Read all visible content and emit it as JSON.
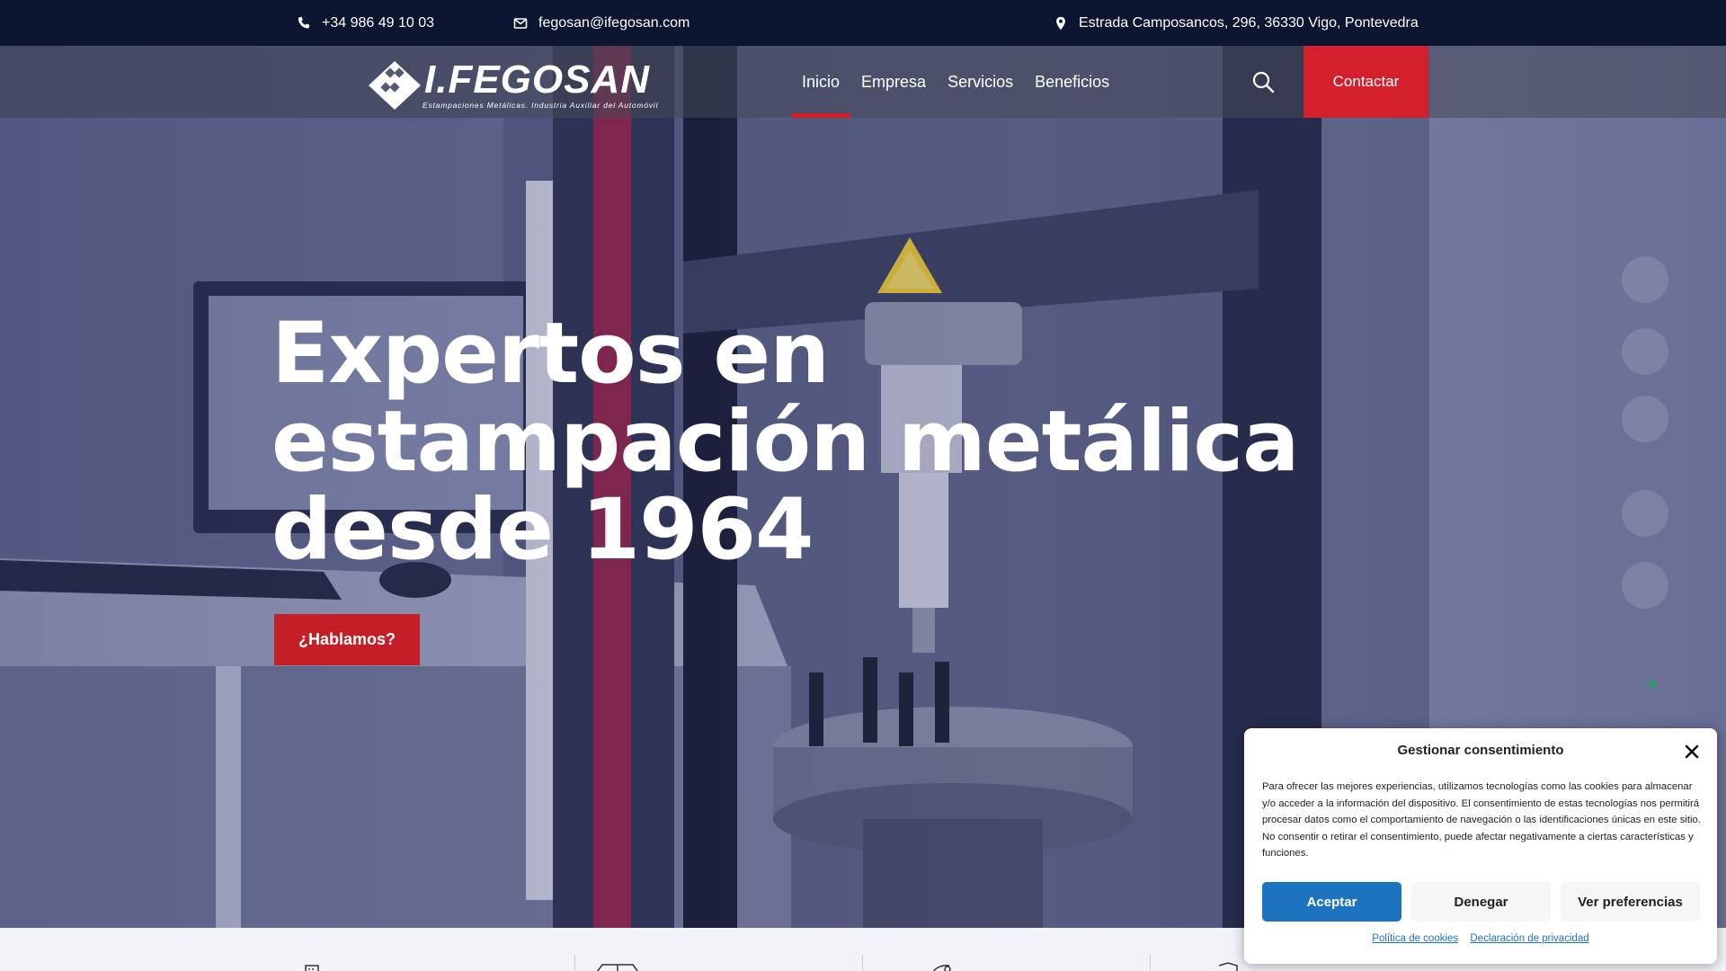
{
  "topbar": {
    "phone": "+34 986 49 10 03",
    "email": "fegosan@ifegosan.com",
    "address": "Estrada Camposancos, 296, 36330 Vigo, Pontevedra"
  },
  "brand": {
    "name": "I.FEGOSAN",
    "tagline": "Estampaciones Metálicas. Industria Auxiliar del Automóvil"
  },
  "nav": {
    "items": [
      {
        "label": "Inicio",
        "active": true
      },
      {
        "label": "Empresa",
        "active": false
      },
      {
        "label": "Servicios",
        "active": false
      },
      {
        "label": "Beneficios",
        "active": false
      }
    ],
    "contact_label": "Contactar"
  },
  "hero": {
    "title_line1": "Expertos en",
    "title_line2": "estampación metálica",
    "title_line3": "desde 1964",
    "cta_label": "¿Hablamos?"
  },
  "cookie": {
    "title": "Gestionar consentimiento",
    "text": "Para ofrecer las mejores experiencias, utilizamos tecnologías como las cookies para almacenar y/o acceder a la información del dispositivo. El consentimiento de estas tecnologías nos permitirá procesar datos como el comportamiento de navegación o las identificaciones únicas en este sitio. No consentir o retirar el consentimiento, puede afectar negativamente a ciertas características y funciones.",
    "accept_label": "Aceptar",
    "deny_label": "Denegar",
    "prefs_label": "Ver preferencias",
    "cookie_policy_link": "Política de cookies",
    "privacy_link": "Declaración de privacidad"
  },
  "colors": {
    "accent_red": "#d4202c",
    "topbar_bg": "#0d1630",
    "cookie_blue": "#1e73be"
  },
  "icons": {
    "phone": "phone-icon",
    "email": "envelope-icon",
    "address": "map-pin-icon",
    "search": "search-icon",
    "close": "close-icon"
  }
}
